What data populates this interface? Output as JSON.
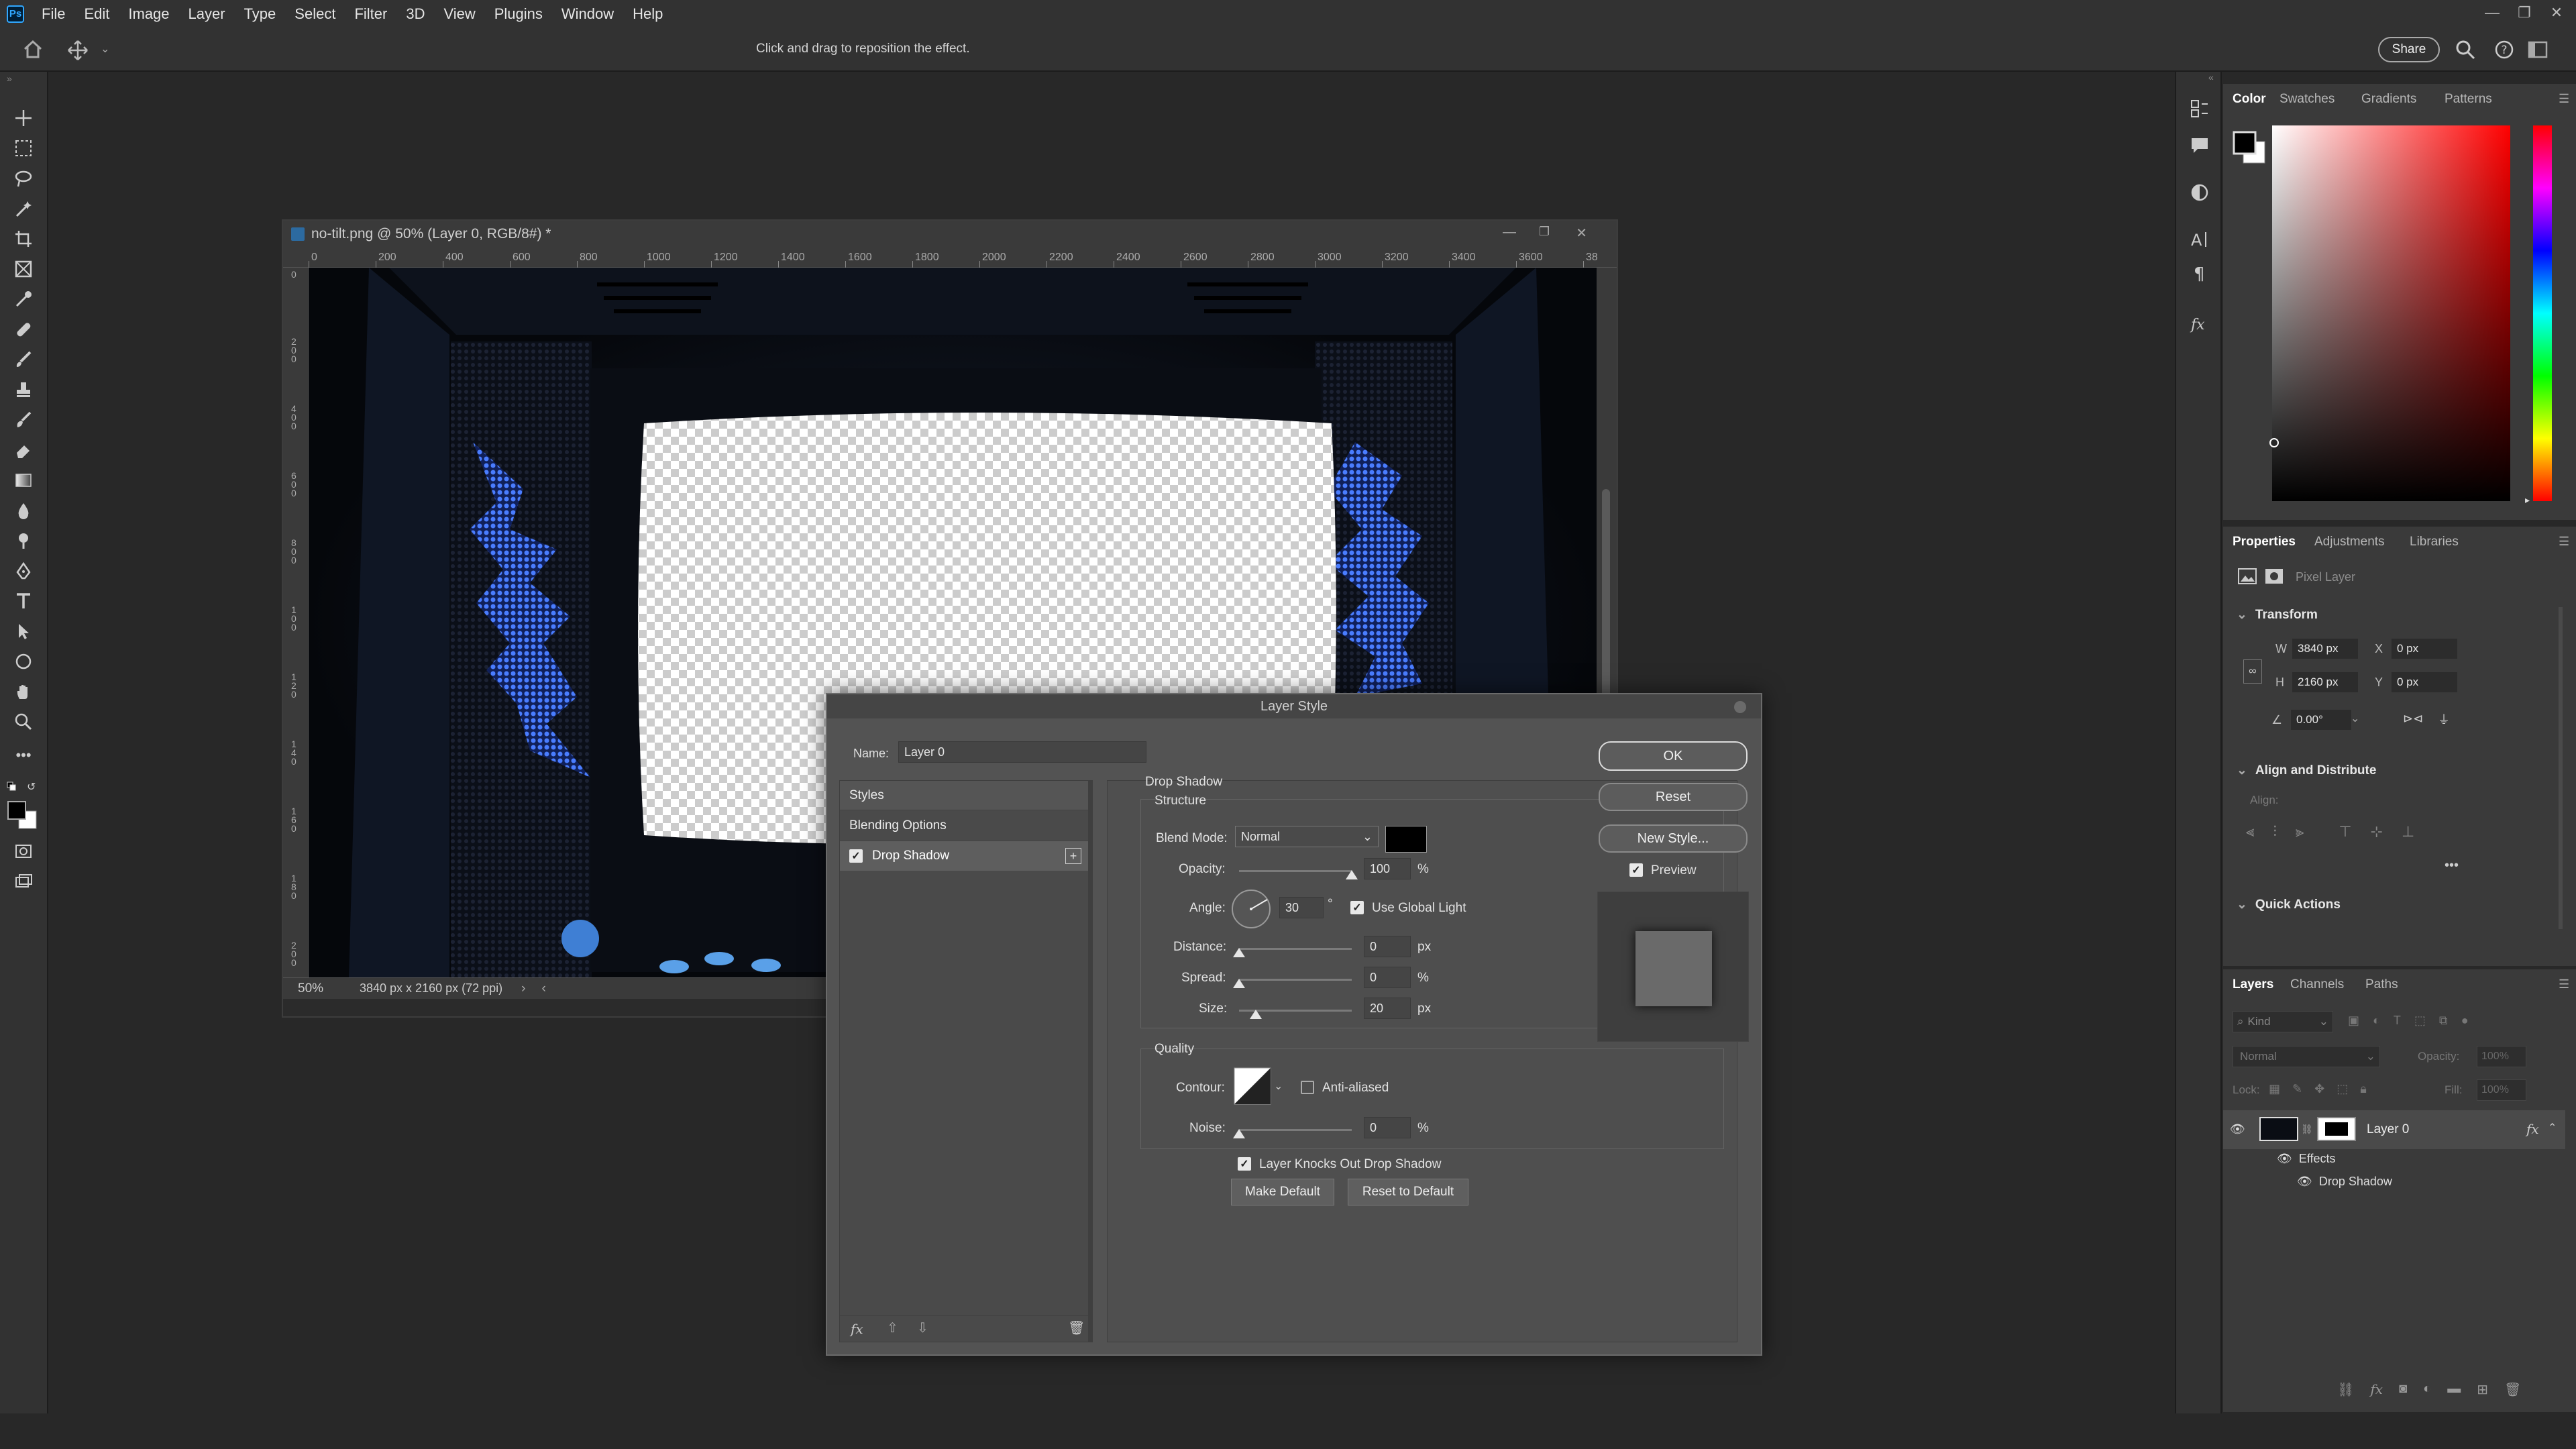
{
  "app": {
    "menus": [
      "File",
      "Edit",
      "Image",
      "Layer",
      "Type",
      "Select",
      "Filter",
      "3D",
      "View",
      "Plugins",
      "Window",
      "Help"
    ],
    "logo_text": "Ps"
  },
  "options_bar": {
    "hint": "Click and drag to reposition the effect.",
    "share_label": "Share"
  },
  "document": {
    "title": "no-tilt.png @ 50% (Layer 0, RGB/8#) *",
    "ruler_h": [
      "0",
      "200",
      "400",
      "600",
      "800",
      "1000",
      "1200",
      "1400",
      "1600",
      "1800",
      "2000",
      "2200",
      "2400",
      "2600",
      "2800",
      "3000",
      "3200",
      "3400",
      "3600",
      "38"
    ],
    "ruler_v": [
      "0",
      "2 0 0",
      "4 0 0",
      "6 0 0",
      "8 0 0",
      "1 0 0",
      "1 2 0",
      "1 4 0",
      "1 6 0",
      "1 8 0",
      "2 0 0"
    ],
    "zoom": "50%",
    "status": "3840 px x 2160 px (72 ppi)"
  },
  "color_panel": {
    "tabs": [
      "Color",
      "Swatches",
      "Gradients",
      "Patterns"
    ],
    "active": "Color"
  },
  "properties_panel": {
    "tabs": [
      "Properties",
      "Adjustments",
      "Libraries"
    ],
    "layer_kind": "Pixel Layer",
    "transform_title": "Transform",
    "w_label": "W",
    "w_value": "3840 px",
    "h_label": "H",
    "h_value": "2160 px",
    "x_label": "X",
    "x_value": "0 px",
    "y_label": "Y",
    "y_value": "0 px",
    "angle_value": "0.00°",
    "align_title": "Align and Distribute",
    "align_label": "Align:",
    "quick_title": "Quick Actions"
  },
  "layers_panel": {
    "tabs": [
      "Layers",
      "Channels",
      "Paths"
    ],
    "kind_placeholder": "Kind",
    "blend_mode": "Normal",
    "opacity_label": "Opacity:",
    "opacity_value": "100%",
    "lock_label": "Lock:",
    "fill_label": "Fill:",
    "fill_value": "100%",
    "layer_name": "Layer 0",
    "effects_label": "Effects",
    "effect_name": "Drop Shadow",
    "fx_symbol": "fx"
  },
  "dialog": {
    "title": "Layer Style",
    "name_label": "Name:",
    "name_value": "Layer 0",
    "styles_header": "Styles",
    "blending_options": "Blending Options",
    "drop_shadow_item": "Drop Shadow",
    "section_title": "Drop Shadow",
    "structure_title": "Structure",
    "blend_mode_label": "Blend Mode:",
    "blend_mode_value": "Normal",
    "shadow_color": "#000000",
    "opacity_label": "Opacity:",
    "opacity_value": "100",
    "opacity_unit": "%",
    "angle_label": "Angle:",
    "angle_value": "30",
    "angle_unit": "°",
    "global_light_label": "Use Global Light",
    "distance_label": "Distance:",
    "distance_value": "0",
    "distance_unit": "px",
    "spread_label": "Spread:",
    "spread_value": "0",
    "spread_unit": "%",
    "size_label": "Size:",
    "size_value": "20",
    "size_unit": "px",
    "quality_title": "Quality",
    "contour_label": "Contour:",
    "anti_aliased_label": "Anti-aliased",
    "noise_label": "Noise:",
    "noise_value": "0",
    "noise_unit": "%",
    "knocks_out_label": "Layer Knocks Out Drop Shadow",
    "make_default": "Make Default",
    "reset_to_default": "Reset to Default",
    "ok": "OK",
    "reset": "Reset",
    "new_style": "New Style...",
    "preview_label": "Preview",
    "fx_footer": "fx"
  }
}
